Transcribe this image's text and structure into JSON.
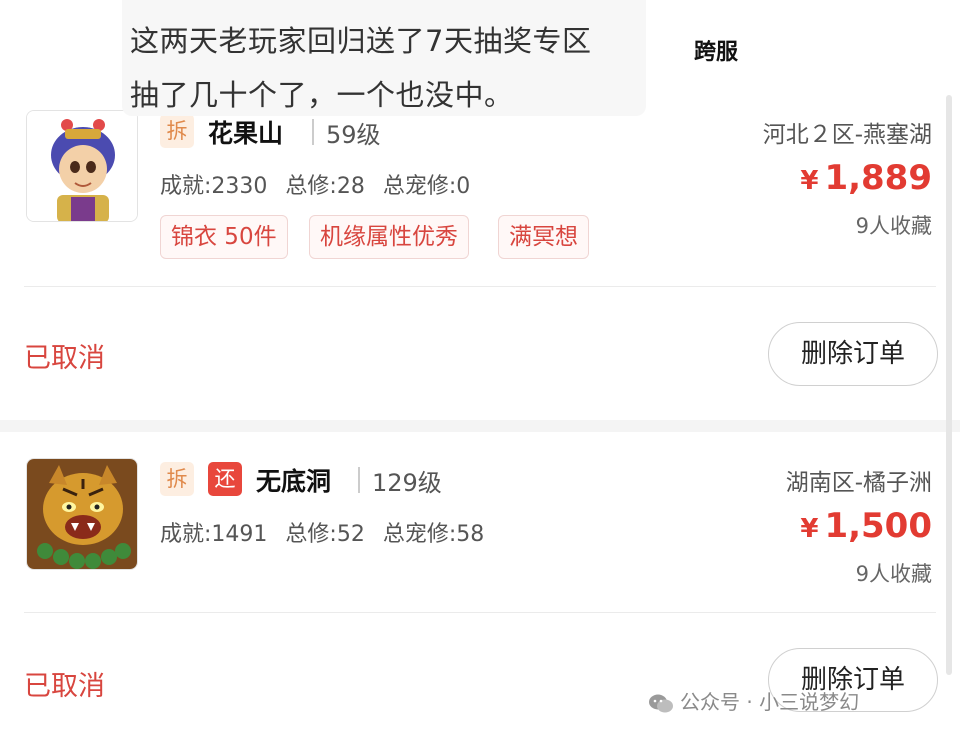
{
  "overlay_text": {
    "line1": "这两天老玩家回归送了7天抽奖专区",
    "line2": "抽了几十个了，一个也没中。"
  },
  "cross_server_label": "跨服",
  "orders": [
    {
      "badges": [
        "拆"
      ],
      "name": "花果山",
      "level": "59级",
      "stats": [
        "成就:2330",
        "总修:28",
        "总宠修:0"
      ],
      "tags": [
        "锦衣 50件",
        "机缘属性优秀",
        "满冥想"
      ],
      "server": "河北２区-燕塞湖",
      "price": "1,889",
      "currency": "¥",
      "favorites": "9人收藏",
      "status": "已取消",
      "action": "删除订单"
    },
    {
      "badges": [
        "拆",
        "还"
      ],
      "name": "无底洞",
      "level": "129级",
      "stats": [
        "成就:1491",
        "总修:52",
        "总宠修:58"
      ],
      "tags": [],
      "server": "湖南区-橘子洲",
      "price": "1,500",
      "currency": "¥",
      "favorites": "9人收藏",
      "status": "已取消",
      "action": "删除订单"
    }
  ],
  "watermark": "公众号 · 小三说梦幻",
  "colors": {
    "price": "#e23b32",
    "status": "#d8463f",
    "badge_chai_bg": "#fdeee1",
    "badge_huan_bg": "#e8473c"
  },
  "icons": {
    "avatar_1": "monkey-king-avatar",
    "avatar_2": "tiger-demon-avatar",
    "watermark": "wechat-icon"
  }
}
